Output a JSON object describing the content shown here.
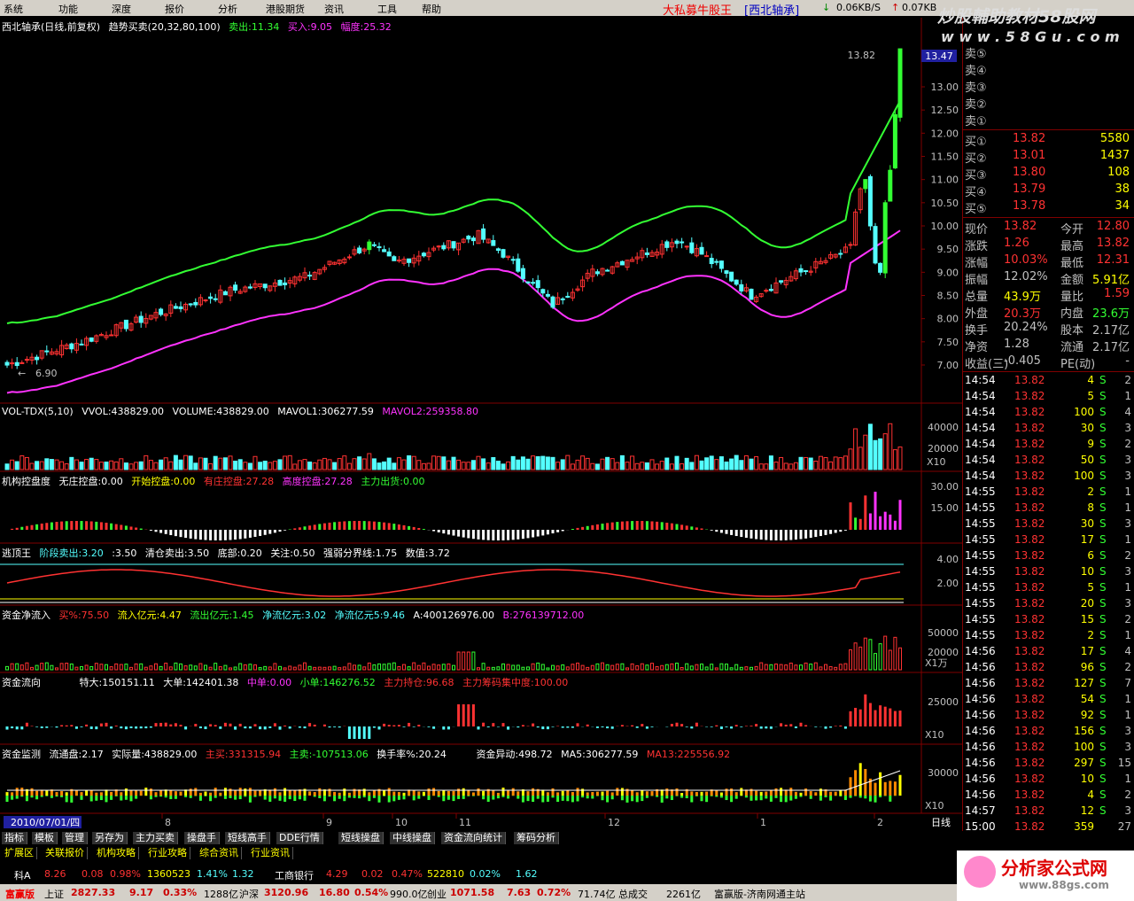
{
  "menubar": {
    "items": [
      "系统",
      "功能",
      "深度",
      "报价",
      "分析",
      "港股期货",
      "资讯",
      "工具",
      "帮助"
    ],
    "title": "大私募牛股王",
    "stock_tag": "[西北轴承]",
    "net_speed": "0.06KB/S",
    "net_speed2": "0.07KB"
  },
  "watermark": {
    "line1": "炒股輔助教材58股网",
    "line2": "w w w . 5 8 G u . c o m",
    "bottom": "分析家公式网",
    "bottom_url": "www.88gs.com"
  },
  "colors": {
    "up": "#ff3232",
    "down": "#54ffff",
    "upper_band": "#33ff33",
    "lower_band": "#ff33ff",
    "magenta": "#ff33ff",
    "yellow": "#ffff00",
    "grid": "#800000"
  },
  "main_panel": {
    "title": "西北轴承(日线,前复权)",
    "indicator": "趋势买卖(20,32,80,100)",
    "sell": "卖出:11.34",
    "buy": "买入:9.05",
    "amplitude": "幅度:25.32",
    "high_label": "13.82",
    "low_label": "6.90",
    "current_price_tag": "13.47",
    "y_ticks": [
      "13.00",
      "12.50",
      "12.00",
      "11.50",
      "11.00",
      "10.50",
      "10.00",
      "9.50",
      "9.00",
      "8.50",
      "8.00",
      "7.50",
      "7.00"
    ]
  },
  "vol_panel": {
    "title": "VOL-TDX(5,10)",
    "vvol": "VVOL:438829.00",
    "volume": "VOLUME:438829.00",
    "mavol1": "MAVOL1:306277.59",
    "mavol2": "MAVOL2:259358.80",
    "y_ticks": [
      "40000",
      "20000"
    ],
    "unit": "X10"
  },
  "jgkp_panel": {
    "title": "机构控盘度",
    "a": "无庄控盘:0.00",
    "b": "开始控盘:0.00",
    "c": "有庄控盘:27.28",
    "d": "高度控盘:27.28",
    "e": "主力出货:0.00",
    "y_ticks": [
      "30.00",
      "15.00"
    ]
  },
  "tdw_panel": {
    "title": "逃顶王",
    "a": "阶段卖出:3.20",
    "b": ":3.50",
    "c": "清仓卖出:3.50",
    "d": "底部:0.20",
    "e": "关注:0.50",
    "f": "强弱分界线:1.75",
    "g": "数值:3.72",
    "y_ticks": [
      "4.00",
      "2.00"
    ]
  },
  "zjjlr_panel": {
    "title": "资金净流入",
    "a": "买%:75.50",
    "b": "流入亿元:4.47",
    "c": "流出亿元:1.45",
    "d": "净流亿元:3.02",
    "e": "净流亿元5:9.46",
    "f": "A:400126976.00",
    "g": "B:276139712.00",
    "y_ticks": [
      "50000",
      "20000"
    ],
    "unit": "X1万"
  },
  "zjlx_panel": {
    "title": "资金流向",
    "a": "特大:150151.11",
    "b": "大单:142401.38",
    "c": "中单:0.00",
    "d": "小单:146276.52",
    "e": "主力持仓:96.68",
    "f": "主力筹码集中度:100.00",
    "y_ticks": [
      "25000"
    ],
    "unit": "X10"
  },
  "zjjk_panel": {
    "title": "资金监测",
    "a": "流通盘:2.17",
    "b": "实际量:438829.00",
    "c": "主买:331315.94",
    "d": "主卖:-107513.06",
    "e": "换手率%:20.24",
    "f": "资金异动:498.72",
    "g": "MA5:306277.59",
    "h": "MA13:225556.92",
    "y_ticks": [
      "30000"
    ],
    "unit": "X10"
  },
  "xaxis": {
    "first": "2010/07/01/四",
    "labels": [
      "8",
      "9",
      "10",
      "11",
      "12",
      "1",
      "2"
    ],
    "period": "日线"
  },
  "orderbook": {
    "sell": [
      {
        "label": "卖⑤",
        "price": "",
        "vol": ""
      },
      {
        "label": "卖④",
        "price": "",
        "vol": ""
      },
      {
        "label": "卖③",
        "price": "",
        "vol": ""
      },
      {
        "label": "卖②",
        "price": "",
        "vol": ""
      },
      {
        "label": "卖①",
        "price": "",
        "vol": ""
      }
    ],
    "buy": [
      {
        "label": "买①",
        "price": "13.82",
        "vol": "5580"
      },
      {
        "label": "买②",
        "price": "13.01",
        "vol": "1437"
      },
      {
        "label": "买③",
        "price": "13.80",
        "vol": "108"
      },
      {
        "label": "买④",
        "price": "13.79",
        "vol": "38"
      },
      {
        "label": "买⑤",
        "price": "13.78",
        "vol": "34"
      }
    ]
  },
  "quote": [
    {
      "k1": "现价",
      "v1": "13.82",
      "k2": "今开",
      "v2": "12.80",
      "c1": "#ff3232",
      "c2": "#ff3232"
    },
    {
      "k1": "涨跌",
      "v1": "1.26",
      "k2": "最高",
      "v2": "13.82",
      "c1": "#ff3232",
      "c2": "#ff3232"
    },
    {
      "k1": "涨幅",
      "v1": "10.03%",
      "k2": "最低",
      "v2": "12.31",
      "c1": "#ff3232",
      "c2": "#ff3232"
    },
    {
      "k1": "振幅",
      "v1": "12.02%",
      "k2": "金额",
      "v2": "5.91亿",
      "c1": "#c0c0c0",
      "c2": "#ffff00"
    },
    {
      "k1": "总量",
      "v1": "43.9万",
      "k2": "量比",
      "v2": "1.59",
      "c1": "#ffff00",
      "c2": "#ff3232"
    },
    {
      "k1": "外盘",
      "v1": "20.3万",
      "k2": "内盘",
      "v2": "23.6万",
      "c1": "#ff3232",
      "c2": "#33ff33"
    },
    {
      "k1": "换手",
      "v1": "20.24%",
      "k2": "股本",
      "v2": "2.17亿",
      "c1": "#c0c0c0",
      "c2": "#c0c0c0"
    },
    {
      "k1": "净资",
      "v1": "1.28",
      "k2": "流通",
      "v2": "2.17亿",
      "c1": "#c0c0c0",
      "c2": "#c0c0c0"
    },
    {
      "k1": "收益(三)",
      "v1": "-0.405",
      "k2": "PE(动)",
      "v2": "-",
      "c1": "#c0c0c0",
      "c2": "#c0c0c0"
    }
  ],
  "ticks": [
    [
      "14:54",
      "13.82",
      "4",
      "S",
      "2"
    ],
    [
      "14:54",
      "13.82",
      "5",
      "S",
      "1"
    ],
    [
      "14:54",
      "13.82",
      "100",
      "S",
      "4"
    ],
    [
      "14:54",
      "13.82",
      "30",
      "S",
      "3"
    ],
    [
      "14:54",
      "13.82",
      "9",
      "S",
      "2"
    ],
    [
      "14:54",
      "13.82",
      "50",
      "S",
      "3"
    ],
    [
      "14:54",
      "13.82",
      "100",
      "S",
      "3"
    ],
    [
      "14:55",
      "13.82",
      "2",
      "S",
      "1"
    ],
    [
      "14:55",
      "13.82",
      "8",
      "S",
      "1"
    ],
    [
      "14:55",
      "13.82",
      "30",
      "S",
      "3"
    ],
    [
      "14:55",
      "13.82",
      "17",
      "S",
      "1"
    ],
    [
      "14:55",
      "13.82",
      "6",
      "S",
      "2"
    ],
    [
      "14:55",
      "13.82",
      "10",
      "S",
      "3"
    ],
    [
      "14:55",
      "13.82",
      "5",
      "S",
      "1"
    ],
    [
      "14:55",
      "13.82",
      "20",
      "S",
      "3"
    ],
    [
      "14:55",
      "13.82",
      "15",
      "S",
      "2"
    ],
    [
      "14:55",
      "13.82",
      "2",
      "S",
      "1"
    ],
    [
      "14:56",
      "13.82",
      "17",
      "S",
      "4"
    ],
    [
      "14:56",
      "13.82",
      "96",
      "S",
      "2"
    ],
    [
      "14:56",
      "13.82",
      "127",
      "S",
      "7"
    ],
    [
      "14:56",
      "13.82",
      "54",
      "S",
      "1"
    ],
    [
      "14:56",
      "13.82",
      "92",
      "S",
      "1"
    ],
    [
      "14:56",
      "13.82",
      "156",
      "S",
      "3"
    ],
    [
      "14:56",
      "13.82",
      "100",
      "S",
      "3"
    ],
    [
      "14:56",
      "13.82",
      "297",
      "S",
      "15"
    ],
    [
      "14:56",
      "13.82",
      "10",
      "S",
      "1"
    ],
    [
      "14:56",
      "13.82",
      "4",
      "S",
      "2"
    ],
    [
      "14:57",
      "13.82",
      "12",
      "S",
      "3"
    ],
    [
      "15:00",
      "13.82",
      "359",
      "",
      "27"
    ]
  ],
  "tabs": [
    "指标",
    "模板",
    "管理",
    "另存为",
    "主力买卖",
    "操盘手",
    "短线高手",
    "DDE行情",
    "短线操盘",
    "中线操盘",
    "资金流向统计",
    "筹码分析"
  ],
  "tabs2": [
    "扩展区",
    "关联报价",
    "机构攻略",
    "行业攻略",
    "综合资讯",
    "行业资讯"
  ],
  "statusbar1": {
    "a": "科A",
    "b": "8.26",
    "c": "0.08",
    "d": "0.98%",
    "e": "1360523",
    "f": "1.41%",
    "g": "1.32",
    "h": "工商银行",
    "i": "4.29",
    "j": "0.02",
    "k": "0.47%",
    "l": "522810",
    "m": "0.02%",
    "n": "1.62"
  },
  "statusbar2": {
    "a": "富赢版",
    "b": "上证",
    "c": "2827.33",
    "d": "9.17",
    "e": "0.33%",
    "f": "1288亿",
    "g": "沪深",
    "h": "3120.96",
    "i": "16.80",
    "j": "0.54%",
    "k": "990.0亿",
    "l": "创业",
    "m": "1071.58",
    "n": "7.63",
    "o": "0.72%",
    "p": "71.74亿",
    "q": "总成交",
    "r": "2261亿",
    "s": "富赢版-济南网通主站"
  }
}
